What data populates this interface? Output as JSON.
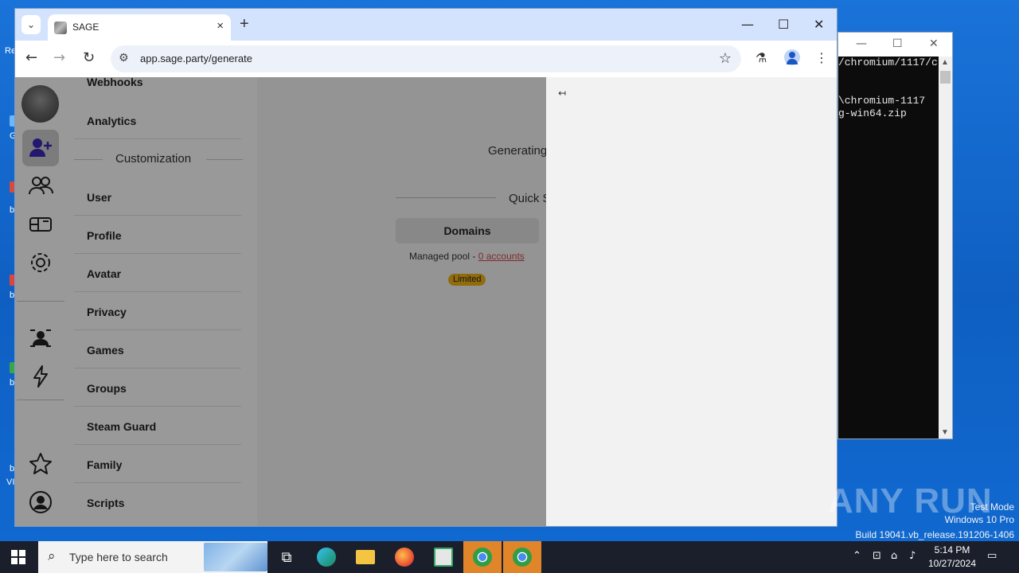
{
  "desktop": {
    "watermark_text": "ANY RUN",
    "watermark_lines": [
      "Test Mode",
      "Windows 10 Pro",
      "Build 19041.vb_release.191206-1406"
    ],
    "edge_fragments": [
      "Re",
      "G",
      "b",
      "b",
      "b",
      "b",
      "VI"
    ]
  },
  "console": {
    "lines": [
      "/chromium/1117/c",
      "",
      "",
      "\\chromium-1117",
      "g-win64.zip"
    ]
  },
  "browser": {
    "tab_title": "SAGE",
    "url": "app.sage.party/generate"
  },
  "sidebar": {
    "partial_top_item": "Webhooks",
    "items_before": [
      "Analytics"
    ],
    "section_label": "Customization",
    "items": [
      "User",
      "Profile",
      "Avatar",
      "Privacy",
      "Games",
      "Groups",
      "Steam Guard",
      "Family",
      "Scripts"
    ]
  },
  "main": {
    "generating_text": "Generating",
    "quick_text": "Quick S",
    "domains_button": "Domains",
    "pool_text": "Managed pool - ",
    "pool_link": "0 accounts",
    "badge": "Limited",
    "badge_color": "#f2b516"
  },
  "drawer": {
    "collapse_icon": "arrow-collapse-icon"
  },
  "taskbar": {
    "search_placeholder": "Type here to search",
    "time": "5:14 PM",
    "date": "10/27/2024"
  }
}
